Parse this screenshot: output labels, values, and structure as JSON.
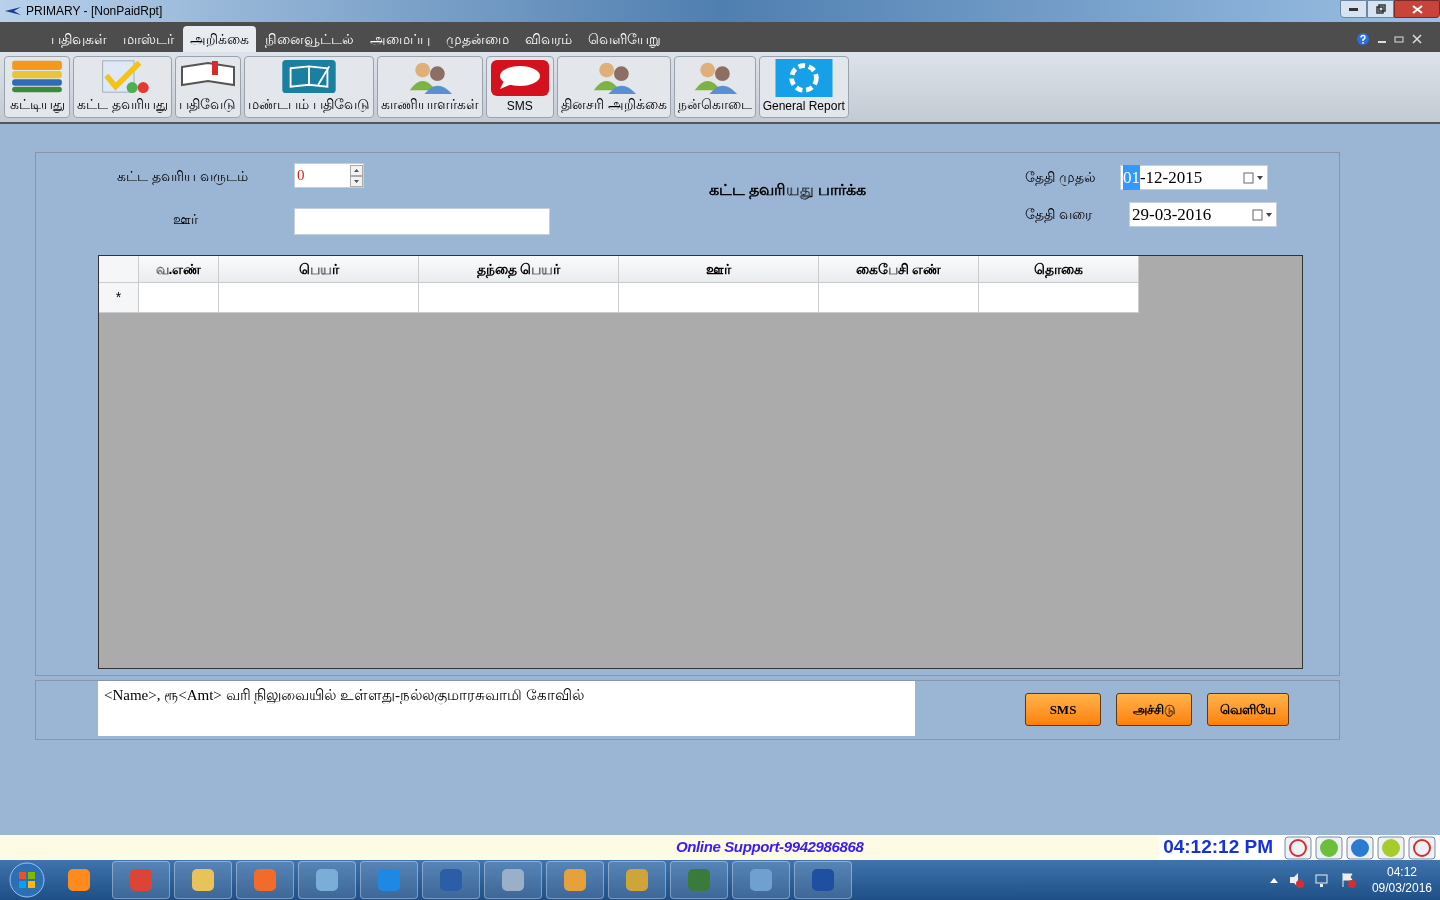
{
  "window": {
    "title": "PRIMARY - [NonPaidRpt]"
  },
  "menu": [
    {
      "label": "பதிவுகள்",
      "selected": false
    },
    {
      "label": "மாஸ்டர்",
      "selected": false
    },
    {
      "label": "அறிக்கை",
      "selected": true
    },
    {
      "label": "நினைவூட்டல்",
      "selected": false
    },
    {
      "label": "அமைப்பு",
      "selected": false
    },
    {
      "label": "முதன்மை",
      "selected": false
    },
    {
      "label": "விவரம்",
      "selected": false
    },
    {
      "label": "வெளியேறு",
      "selected": false
    }
  ],
  "toolbar": [
    {
      "label": "கட்டியது",
      "kind": "stack"
    },
    {
      "label": "கட்ட தவரியது",
      "kind": "check"
    },
    {
      "label": "பதிவேடு",
      "kind": "book"
    },
    {
      "label": "மண்டபம் பதிவேடு",
      "kind": "hall"
    },
    {
      "label": "காணியாளர்கள்",
      "kind": "people"
    },
    {
      "label": "SMS",
      "kind": "sms"
    },
    {
      "label": "தினசரி அறிக்கை",
      "kind": "people"
    },
    {
      "label": "நன்கொடை",
      "kind": "people"
    },
    {
      "label": "General Report",
      "kind": "cycle"
    }
  ],
  "form": {
    "title": "கட்ட தவரியது பார்க்க",
    "year_label": "கட்ட தவரிய வருடம்",
    "year_value": "0",
    "village_label": "ஊர்",
    "from_label": "தேதி முதல்",
    "from_parts": [
      {
        "text": "01",
        "selected": true
      },
      {
        "text": "-12-2015",
        "selected": false
      }
    ],
    "to_label": "தேதி வரை",
    "to_parts": [
      {
        "text": "29-03-2016",
        "selected": false
      }
    ]
  },
  "table": {
    "columns": [
      "வ.எண்",
      "பெயர்",
      "தந்தை பெயர்",
      "ஊர்",
      "கைபேசி எண்",
      "தொகை"
    ],
    "new_row_marker": "*"
  },
  "message": "<Name>, ரூ<Amt> வரி நிலுவையில் உள்ளது-நல்லகுமாரசுவாமி கோவில்",
  "buttons": [
    "SMS",
    "அச்சிடு",
    "வெளியே"
  ],
  "status_bar": {
    "support": "Online Support-9942986868",
    "clock": "04:12:12 PM"
  },
  "tray": {
    "time": "04:12",
    "date": "09/03/2016"
  }
}
